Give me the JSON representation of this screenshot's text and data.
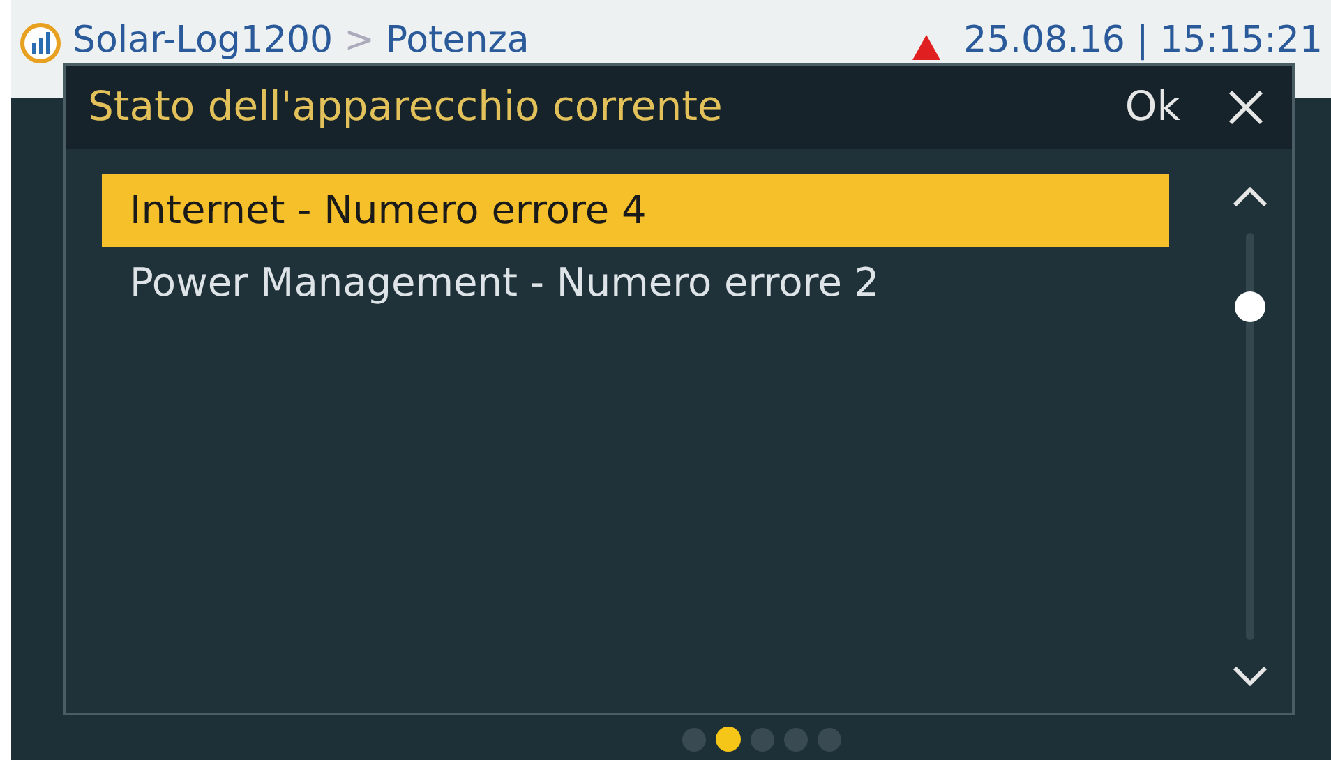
{
  "status_bar": {
    "device": "Solar-Log1200",
    "separator": ">",
    "page": "Potenza",
    "date": "25.08.16",
    "divider": "|",
    "time": "15:15:21"
  },
  "dialog": {
    "title": "Stato dell'apparecchio corrente",
    "ok": "Ok",
    "items": [
      {
        "label": "Internet - Numero errore 4",
        "selected": true
      },
      {
        "label": "Power Management - Numero errore 2",
        "selected": false
      }
    ]
  },
  "pages": [
    {
      "selected": false
    },
    {
      "selected": true
    },
    {
      "selected": false
    },
    {
      "selected": false
    },
    {
      "selected": false
    }
  ]
}
